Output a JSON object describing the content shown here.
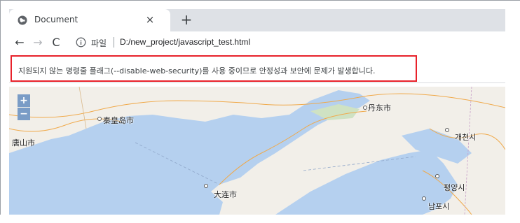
{
  "browser": {
    "tab_title": "Document",
    "close_glyph": "×",
    "new_tab_glyph": "+",
    "back_glyph": "←",
    "forward_glyph": "→",
    "reload_glyph": "C",
    "site_label": "파일",
    "url": "D:/new_project/javascript_test.html"
  },
  "infobar": {
    "message": "지원되지 않는 명령줄 플래그(--disable-web-security)를 사용 중이므로 안정성과 보안에 문제가 발생합니다.",
    "highlight_color": "#e8212a"
  },
  "map": {
    "zoom_in": "+",
    "zoom_out": "−",
    "cities": {
      "qinhuangdao": "秦皇岛市",
      "tangshan": "唐山市",
      "dandong": "丹东市",
      "kaecheon": "개천시",
      "dalian": "大连市",
      "pyongyang": "평양시",
      "nampo": "남포시"
    },
    "sea_color": "#b5d0ef",
    "land_color": "#f2efe9"
  }
}
